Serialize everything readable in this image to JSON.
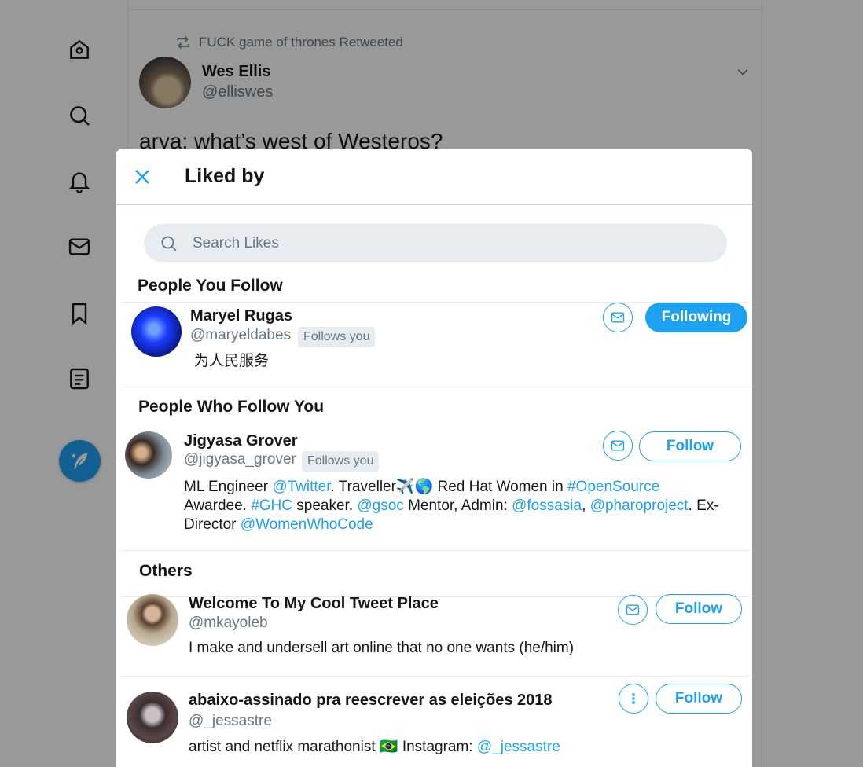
{
  "background": {
    "retweet_label": "FUCK game of thrones Retweeted",
    "tweet_author_name": "Wes Ellis",
    "tweet_author_handle": "@elliswes",
    "tweet_text": "arya: what’s west of Westeros?"
  },
  "modal": {
    "title": "Liked by",
    "search_placeholder": "Search Likes",
    "sections": {
      "people_you_follow": "People You Follow",
      "people_who_follow_you": "People Who Follow You",
      "others": "Others"
    },
    "users": [
      {
        "name": "Maryel Rugas",
        "handle": "@maryeldabes",
        "badge": "Follows you",
        "bio": "为人民服务",
        "action": "Following"
      },
      {
        "name": "Jigyasa Grover",
        "handle": "@jigyasa_grover",
        "badge": "Follows you",
        "bio_parts": {
          "l1a": "ML Engineer ",
          "l1b": "@Twitter",
          "l1c": ". Traveller✈️🌎 Red Hat Women in ",
          "l1d": "#OpenSource",
          "l2a": "Awardee. ",
          "l2b": "#GHC",
          "l2c": " speaker. ",
          "l2d": "@gsoc",
          "l2e": " Mentor, Admin: ",
          "l2f": "@fossasia",
          "l2g": ", ",
          "l2h": "@pharoproject",
          "l2i": ". Ex-",
          "l3a": "Director ",
          "l3b": "@WomenWhoCode"
        },
        "action": "Follow"
      },
      {
        "name": "Welcome To My Cool Tweet Place",
        "handle": "@mkayoleb",
        "bio": "I make and undersell art online that no one wants (he/him)",
        "action": "Follow"
      },
      {
        "name": "abaixo-assinado pra reescrever as eleições 2018",
        "handle": "@_jessastre",
        "bio_a": "artist and netflix marathonist 🇧🇷 Instagram: ",
        "bio_b": "@_jessastre",
        "action": "Follow"
      }
    ]
  },
  "colors": {
    "accent": "#1da1f2",
    "overlay": "rgba(0,0,0,0.40)",
    "muted_text": "#657786"
  },
  "icons": [
    "home-icon",
    "explore-icon",
    "notifications-icon",
    "messages-icon",
    "bookmarks-icon",
    "lists-icon",
    "compose-tweet-icon",
    "close-icon",
    "search-icon",
    "mail-icon",
    "more-options-icon",
    "retweet-icon",
    "chevron-down-icon"
  ]
}
